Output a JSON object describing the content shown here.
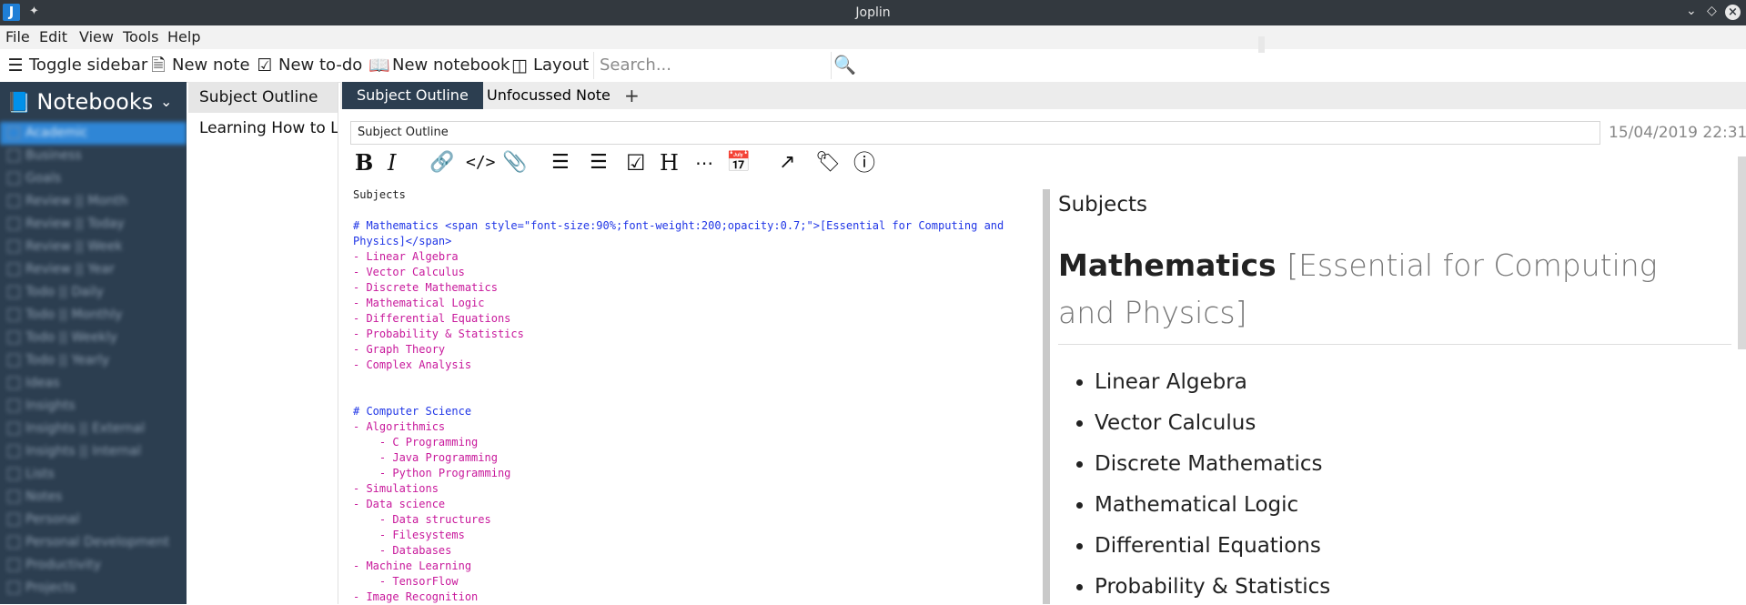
{
  "window": {
    "app_icon": "J",
    "pin_icon": "pin-icon",
    "title": "Joplin"
  },
  "menu": [
    "File",
    "Edit",
    "View",
    "Tools",
    "Help"
  ],
  "toolbar": {
    "toggle_sidebar": "Toggle sidebar",
    "new_note": "New note",
    "new_todo": "New to-do",
    "new_notebook": "New notebook",
    "layout": "Layout",
    "search_placeholder": "Search..."
  },
  "sidebar": {
    "header": "Notebooks",
    "items": [
      {
        "label": "Academic",
        "selected": true
      },
      {
        "label": "Business"
      },
      {
        "label": "Goals"
      },
      {
        "label": "Review || Month"
      },
      {
        "label": "Review || Today"
      },
      {
        "label": "Review || Week"
      },
      {
        "label": "Review || Year"
      },
      {
        "label": "Todo || Daily"
      },
      {
        "label": "Todo || Monthly"
      },
      {
        "label": "Todo || Weekly"
      },
      {
        "label": "Todo || Yearly"
      },
      {
        "label": "Ideas"
      },
      {
        "label": "Insights"
      },
      {
        "label": "Insights || External"
      },
      {
        "label": "Insights || Internal"
      },
      {
        "label": "Lists"
      },
      {
        "label": "Notes"
      },
      {
        "label": "Personal"
      },
      {
        "label": "Personal Development"
      },
      {
        "label": "Productivity"
      },
      {
        "label": "Projects"
      }
    ]
  },
  "notes": [
    {
      "title": "Subject Outline",
      "selected": true
    },
    {
      "title": "Learning How to Learn"
    }
  ],
  "tabs": [
    "Subject Outline",
    "Unfocussed Note"
  ],
  "tab_add": "+",
  "editor": {
    "title": "Subject Outline",
    "date": "15/04/2019 22:31",
    "toolbar_icons": [
      "bold-icon",
      "italic-icon",
      "link-icon",
      "code-icon",
      "attachment-icon",
      "numbered-list-icon",
      "bullet-list-icon",
      "checkbox-list-icon",
      "heading-icon",
      "horizontal-rule-icon",
      "insert-date-icon",
      "external-edit-icon",
      "tags-icon",
      "info-icon"
    ],
    "lines": [
      {
        "t": "Subjects",
        "k": "p"
      },
      {
        "t": "",
        "k": "p"
      },
      {
        "t": "# Mathematics <span style=\"font-size:90%;font-weight:200;opacity:0.7;\">[Essential for Computing and",
        "k": "h"
      },
      {
        "t": "Physics]</span>",
        "k": "h"
      },
      {
        "t": "- Linear Algebra",
        "k": "l"
      },
      {
        "t": "- Vector Calculus",
        "k": "l"
      },
      {
        "t": "- Discrete Mathematics",
        "k": "l"
      },
      {
        "t": "- Mathematical Logic",
        "k": "l"
      },
      {
        "t": "- Differential Equations",
        "k": "l"
      },
      {
        "t": "- Probability & Statistics",
        "k": "l"
      },
      {
        "t": "- Graph Theory",
        "k": "l"
      },
      {
        "t": "- Complex Analysis",
        "k": "l"
      },
      {
        "t": "",
        "k": "p"
      },
      {
        "t": "",
        "k": "p"
      },
      {
        "t": "# Computer Science",
        "k": "h"
      },
      {
        "t": "- Algorithmics",
        "k": "l"
      },
      {
        "t": "    - C Programming",
        "k": "l"
      },
      {
        "t": "    - Java Programming",
        "k": "l"
      },
      {
        "t": "    - Python Programming",
        "k": "l"
      },
      {
        "t": "- Simulations",
        "k": "l"
      },
      {
        "t": "- Data science",
        "k": "l"
      },
      {
        "t": "    - Data structures",
        "k": "l"
      },
      {
        "t": "    - Filesystems",
        "k": "l"
      },
      {
        "t": "    - Databases",
        "k": "l"
      },
      {
        "t": "- Machine Learning",
        "k": "l"
      },
      {
        "t": "    - TensorFlow",
        "k": "l"
      },
      {
        "t": "- Image Recognition",
        "k": "l"
      }
    ]
  },
  "viewer": {
    "subtitle": "Subjects",
    "heading": "Mathematics",
    "heading_span": "[Essential for Computing and Physics]",
    "items": [
      "Linear Algebra",
      "Vector Calculus",
      "Discrete Mathematics",
      "Mathematical Logic",
      "Differential Equations",
      "Probability & Statistics"
    ]
  }
}
